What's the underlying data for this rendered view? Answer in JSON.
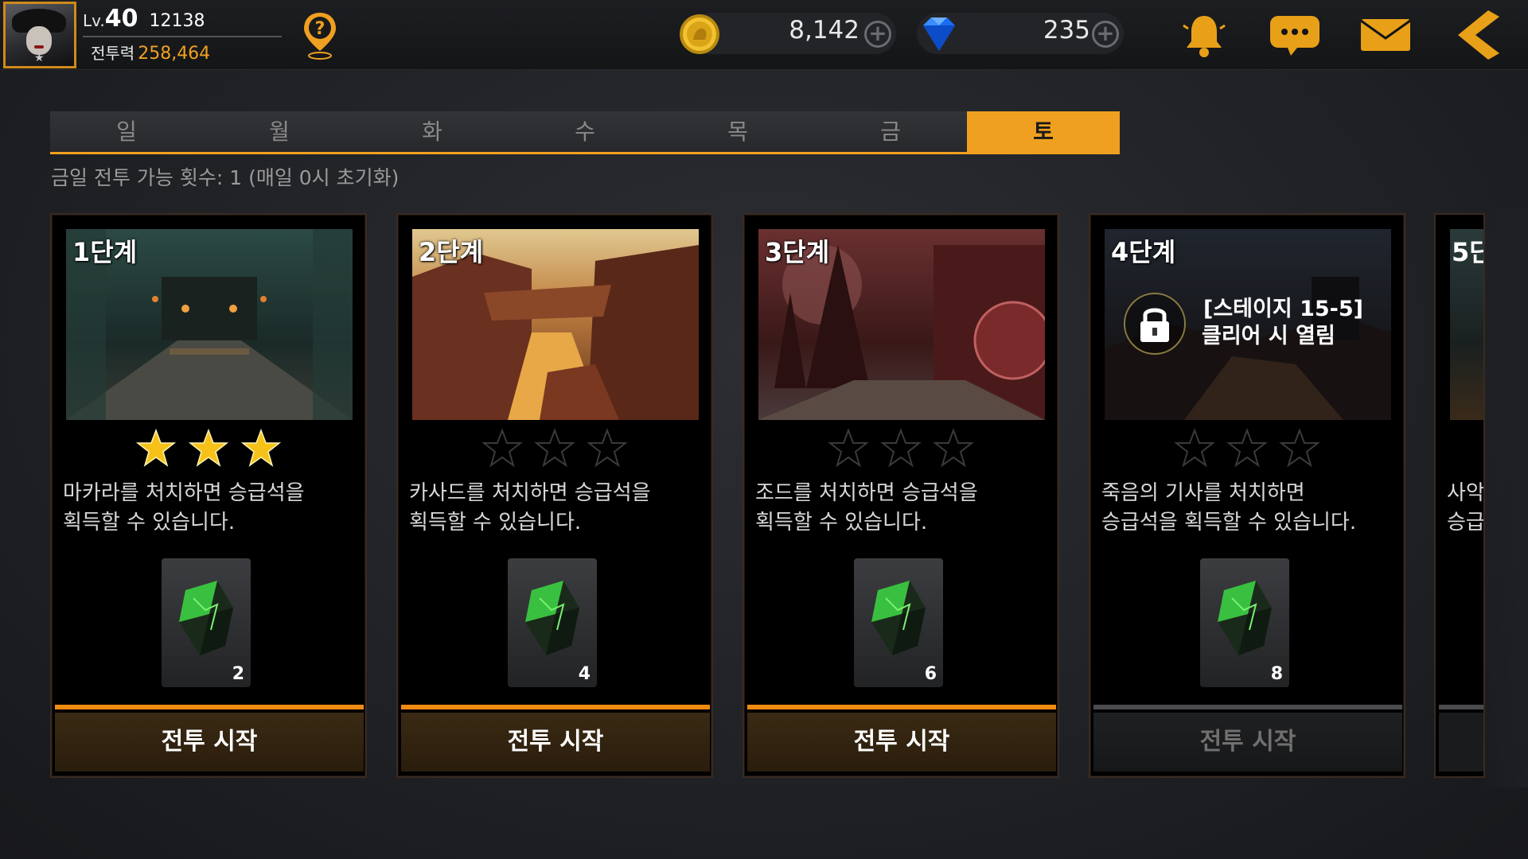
{
  "player": {
    "level_prefix": "Lv.",
    "level": "40",
    "exp": "12138",
    "power_label": "전투력",
    "power": "258,464"
  },
  "currency": {
    "gold": "8,142",
    "gems": "235"
  },
  "colors": {
    "accent": "#f0a020",
    "button_bar": "#f08a10",
    "disabled": "#4a4b4e"
  },
  "tabs": [
    {
      "label": "일",
      "active": false
    },
    {
      "label": "월",
      "active": false
    },
    {
      "label": "화",
      "active": false
    },
    {
      "label": "수",
      "active": false
    },
    {
      "label": "목",
      "active": false
    },
    {
      "label": "금",
      "active": false
    },
    {
      "label": "토",
      "active": true
    }
  ],
  "info_text": "금일 전투 가능 횟수: 1 (매일 0시 초기화)",
  "stages": [
    {
      "label": "1단계",
      "stars": 3,
      "desc_line1": "마카라를 처치하면 승급석을",
      "desc_line2": "획득할 수 있습니다.",
      "reward_count": "2",
      "button": "전투 시작",
      "locked": false
    },
    {
      "label": "2단계",
      "stars": 0,
      "desc_line1": "카사드를 처치하면 승급석을",
      "desc_line2": "획득할 수 있습니다.",
      "reward_count": "4",
      "button": "전투 시작",
      "locked": false
    },
    {
      "label": "3단계",
      "stars": 0,
      "desc_line1": "조드를 처치하면 승급석을",
      "desc_line2": "획득할 수 있습니다.",
      "reward_count": "6",
      "button": "전투 시작",
      "locked": false
    },
    {
      "label": "4단계",
      "stars": 0,
      "desc_line1": "죽음의 기사를 처치하면",
      "desc_line2": "승급석을 획득할 수 있습니다.",
      "reward_count": "8",
      "button": "전투 시작",
      "locked": true,
      "lock_line1": "[스테이지 15-5]",
      "lock_line2": "클리어 시 열림"
    },
    {
      "label": "5단",
      "desc_line1": "사악",
      "desc_line2": "승급"
    }
  ]
}
